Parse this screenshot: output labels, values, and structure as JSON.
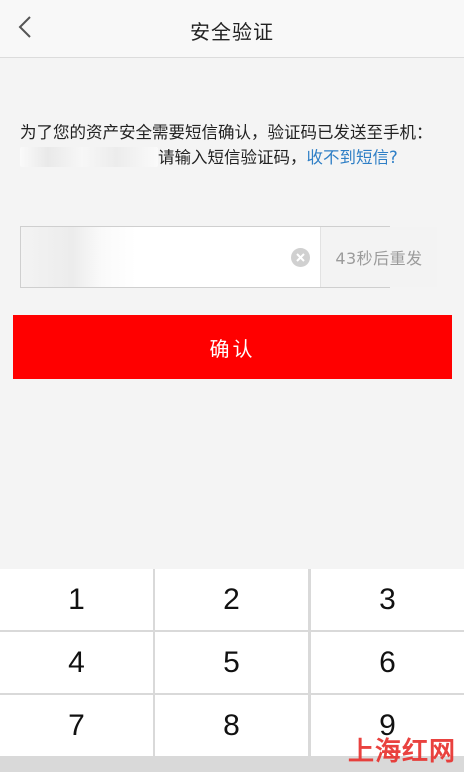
{
  "header": {
    "title": "安全验证",
    "back_icon": "chevron-left-icon"
  },
  "notice": {
    "text_before": "为了您的资产安全需要短信确认，验证码已发送至手机：",
    "text_after": "请输入短信验证码，",
    "link": "收不到短信?"
  },
  "code_field": {
    "value": "",
    "placeholder": "",
    "countdown": "43秒后重发",
    "clear_icon": "clear-circle-icon"
  },
  "confirm_button": {
    "label": "确认",
    "color": "#ff0000"
  },
  "keypad": {
    "keys": [
      "1",
      "2",
      "3",
      "4",
      "5",
      "6",
      "7",
      "8",
      "9"
    ]
  },
  "watermark": "上海红网",
  "colors": {
    "accent": "#ff0000",
    "link": "#2f7fc6",
    "watermark": "#e8322f"
  }
}
